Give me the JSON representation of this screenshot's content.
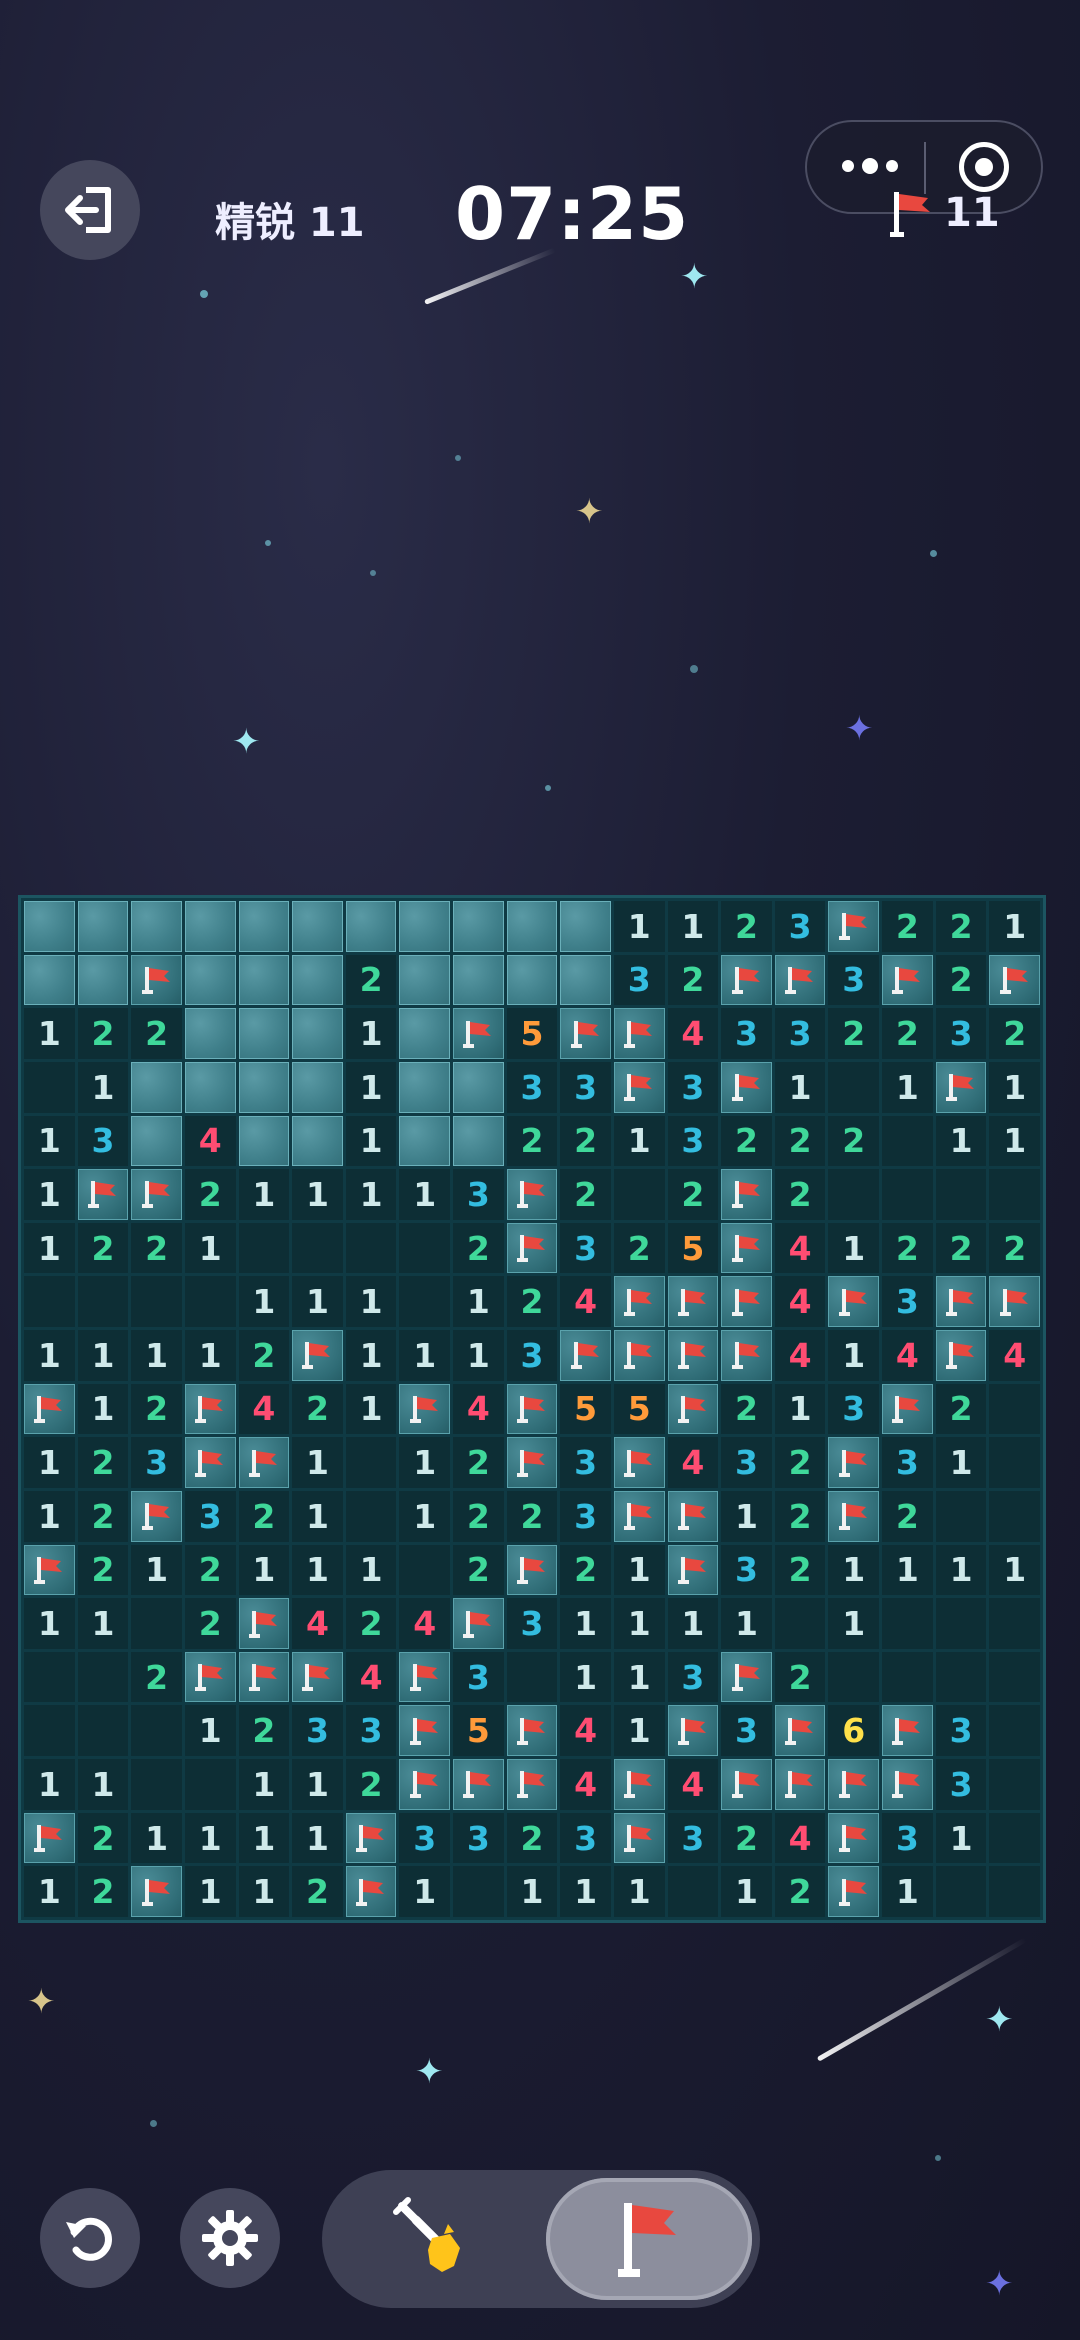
{
  "header": {
    "level": "精锐 11",
    "timer": "07:25",
    "flags_remaining": "11",
    "icons": [
      "exit-icon",
      "more-icon",
      "target-icon",
      "flag-icon"
    ]
  },
  "board": {
    "columns": 19,
    "rows": [
      "HHHHHHHHHHH1123F221",
      "HHFHHH2HHHH32FF3F2F",
      "122HHH1HF5FF4332232",
      "E1HHHH1HH33F3F1E1F1",
      "13H4HH1HH2213222E111",
      "1FF211113F2E2F2EEEE",
      "1221EEEE2F325F41222",
      "EEEE111E124FFF4F3FF",
      "11112F1113FFFF414F4",
      "F12F421F4F55F213F2",
      "123FF1E12F3F432F31",
      "12F321E1223FF12F2E",
      "F212111E2F21F321111E",
      "11E2F424F31111E1EEE",
      "EE2FFF4F3E113F2EEE",
      "EEE1233F5F41F3F6F3EEE",
      "11EE112FFF4F4FFFF3EE",
      "F21111F3323F324F31EE",
      "12F112F1E111E12F1EE"
    ],
    "legend": {
      "H": "unrevealed",
      "F": "flagged",
      "E": "empty",
      "digits": "adjacent mine count"
    }
  },
  "controls": {
    "mode_selected": "flag",
    "icons": [
      "undo-icon",
      "settings-icon",
      "shovel-icon",
      "flag-mode-icon"
    ]
  },
  "colors": {
    "n1": "#cfe9ea",
    "n2": "#3fd89a",
    "n3": "#33bde0",
    "n4": "#ff4d72",
    "n5": "#ff9b3a",
    "n6": "#ffe14a",
    "flag_red": "#e8483f"
  }
}
